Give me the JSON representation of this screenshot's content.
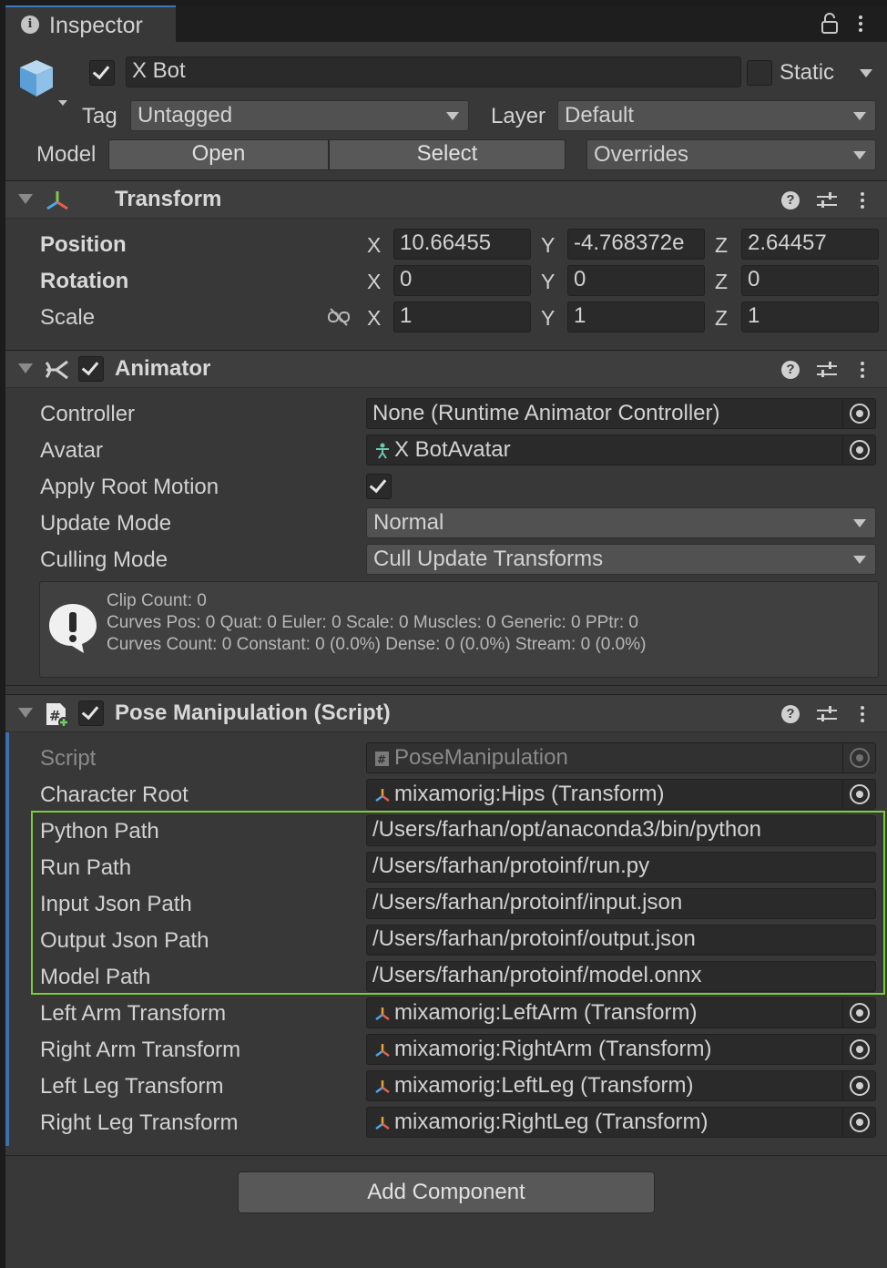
{
  "tab": {
    "label": "Inspector"
  },
  "object": {
    "name": "X Bot",
    "static_label": "Static",
    "tag_label": "Tag",
    "tag_value": "Untagged",
    "layer_label": "Layer",
    "layer_value": "Default",
    "model_label": "Model",
    "open_label": "Open",
    "select_label": "Select",
    "overrides_label": "Overrides"
  },
  "transform": {
    "title": "Transform",
    "position": {
      "label": "Position",
      "x": "10.66455",
      "y": "-4.768372e",
      "z": "2.64457"
    },
    "rotation": {
      "label": "Rotation",
      "x": "0",
      "y": "0",
      "z": "0"
    },
    "scale": {
      "label": "Scale",
      "x": "1",
      "y": "1",
      "z": "1"
    },
    "axis": {
      "x": "X",
      "y": "Y",
      "z": "Z"
    }
  },
  "animator": {
    "title": "Animator",
    "controller_label": "Controller",
    "controller_value": "None (Runtime Animator Controller)",
    "avatar_label": "Avatar",
    "avatar_value": "X BotAvatar",
    "apply_root_motion_label": "Apply Root Motion",
    "update_mode_label": "Update Mode",
    "update_mode_value": "Normal",
    "culling_mode_label": "Culling Mode",
    "culling_mode_value": "Cull Update Transforms",
    "info": {
      "line1": "Clip Count: 0",
      "line2": "Curves Pos: 0 Quat: 0 Euler: 0 Scale: 0 Muscles: 0 Generic: 0 PPtr: 0",
      "line3": "Curves Count: 0 Constant: 0 (0.0%) Dense: 0 (0.0%) Stream: 0 (0.0%)"
    }
  },
  "pose": {
    "title": "Pose Manipulation (Script)",
    "script_label": "Script",
    "script_value": "PoseManipulation",
    "character_root_label": "Character Root",
    "character_root_value": "mixamorig:Hips (Transform)",
    "python_path_label": "Python Path",
    "python_path_value": "/Users/farhan/opt/anaconda3/bin/python",
    "run_path_label": "Run Path",
    "run_path_value": "/Users/farhan/protoinf/run.py",
    "input_json_label": "Input Json Path",
    "input_json_value": "/Users/farhan/protoinf/input.json",
    "output_json_label": "Output Json Path",
    "output_json_value": "/Users/farhan/protoinf/output.json",
    "model_path_label": "Model Path",
    "model_path_value": "/Users/farhan/protoinf/model.onnx",
    "left_arm_label": "Left Arm Transform",
    "left_arm_value": "mixamorig:LeftArm (Transform)",
    "right_arm_label": "Right Arm Transform",
    "right_arm_value": "mixamorig:RightArm (Transform)",
    "left_leg_label": "Left Leg Transform",
    "left_leg_value": "mixamorig:LeftLeg (Transform)",
    "right_leg_label": "Right Leg Transform",
    "right_leg_value": "mixamorig:RightLeg (Transform)"
  },
  "add_component_label": "Add Component",
  "icons": [
    "info-icon",
    "lock-icon",
    "more-icon",
    "cube-icon",
    "transform-icon",
    "animator-icon",
    "script-icon",
    "help-icon",
    "presets-icon",
    "object-picker-icon",
    "unlink-icon",
    "warning-icon",
    "avatar-icon"
  ],
  "colors": {
    "accent": "#3a79bb",
    "highlight": "#7acc3a",
    "background": "#383838"
  }
}
